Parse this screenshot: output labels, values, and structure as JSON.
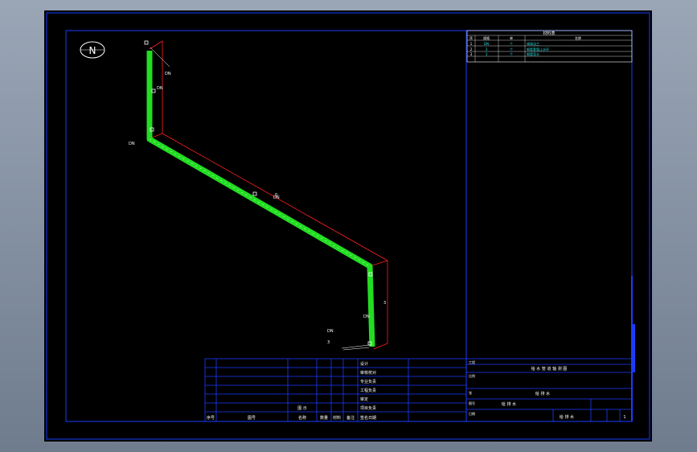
{
  "compass": {
    "letter": "N"
  },
  "pipe_labels": {
    "top_left": "DN",
    "bottom_left": "DN",
    "left_side": "DN",
    "mid_segment": "DN",
    "mid_segment_dim": "0",
    "right_side": "3",
    "bottom_dim": "3",
    "top_right_note": "DN",
    "bottom_right_note": "DN"
  },
  "materials_table": {
    "title": "材料表",
    "headers": [
      "序",
      "规格",
      "单",
      "名称"
    ],
    "rows": [
      [
        "1",
        "DN",
        "个",
        "闸阀法兰"
      ],
      [
        "2",
        "3",
        "个",
        "钢管套管止水环"
      ],
      [
        "3",
        "3",
        "个",
        "钢管弯头"
      ]
    ]
  },
  "title_block": {
    "left_headers": [
      "序号",
      "图号",
      "名称",
      "数量",
      "材料",
      "备注"
    ],
    "sign_labels": [
      "设计",
      "审核校对",
      "专业负责",
      "工程负责",
      "审定",
      "项目负责",
      "签名日期"
    ],
    "center_note": "图 示",
    "project_label": "工程",
    "drawing_title": "给 水 管 道 轴 测 图",
    "scale_label": "比例",
    "sheet_label": "张",
    "subproject": "给 排 水",
    "drawing_no_label": "图号",
    "drawing_no": "给 排 水",
    "date_label": "日期",
    "page": "1"
  }
}
